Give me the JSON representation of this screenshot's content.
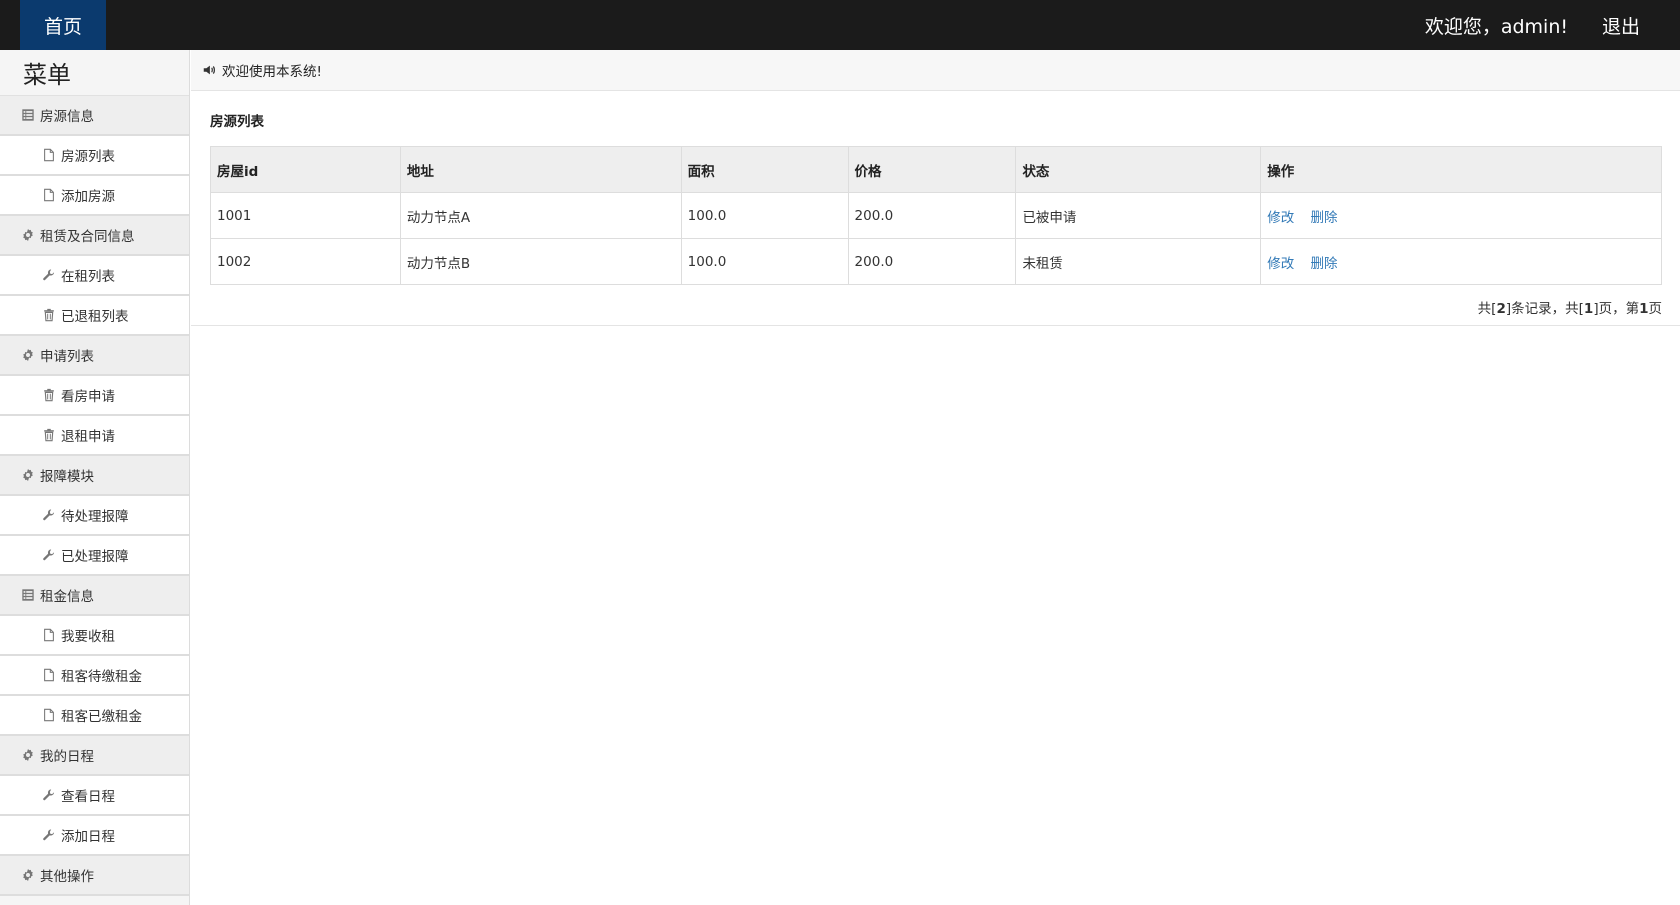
{
  "topbar": {
    "home_label": "首页",
    "welcome_text": "欢迎您，admin!",
    "logout_label": "退出"
  },
  "sidebar": {
    "title": "菜单",
    "groups": [
      {
        "label": "房源信息",
        "icon": "list-alt-icon",
        "items": [
          {
            "label": "房源列表",
            "icon": "file-icon"
          },
          {
            "label": "添加房源",
            "icon": "file-icon"
          }
        ]
      },
      {
        "label": "租赁及合同信息",
        "icon": "gear-icon",
        "items": [
          {
            "label": "在租列表",
            "icon": "wrench-icon"
          },
          {
            "label": "已退租列表",
            "icon": "trash-icon"
          }
        ]
      },
      {
        "label": "申请列表",
        "icon": "gear-icon",
        "items": [
          {
            "label": "看房申请",
            "icon": "trash-icon"
          },
          {
            "label": "退租申请",
            "icon": "trash-icon"
          }
        ]
      },
      {
        "label": "报障模块",
        "icon": "gear-icon",
        "items": [
          {
            "label": "待处理报障",
            "icon": "wrench-icon"
          },
          {
            "label": "已处理报障",
            "icon": "wrench-icon"
          }
        ]
      },
      {
        "label": "租金信息",
        "icon": "list-alt-icon",
        "items": [
          {
            "label": "我要收租",
            "icon": "file-icon"
          },
          {
            "label": "租客待缴租金",
            "icon": "file-icon"
          },
          {
            "label": "租客已缴租金",
            "icon": "file-icon"
          }
        ]
      },
      {
        "label": "我的日程",
        "icon": "gear-icon",
        "items": [
          {
            "label": "查看日程",
            "icon": "wrench-icon"
          },
          {
            "label": "添加日程",
            "icon": "wrench-icon"
          }
        ]
      },
      {
        "label": "其他操作",
        "icon": "gear-icon",
        "items": []
      }
    ]
  },
  "notice": {
    "text": "欢迎使用本系统!",
    "icon": "volume-up-icon"
  },
  "main": {
    "section_title": "房源列表",
    "table": {
      "headers": [
        "房屋id",
        "地址",
        "面积",
        "价格",
        "状态",
        "操作"
      ],
      "rows": [
        {
          "id": "1001",
          "address": "动力节点A",
          "area": "100.0",
          "price": "200.0",
          "status": "已被申请",
          "edit": "修改",
          "delete": "删除"
        },
        {
          "id": "1002",
          "address": "动力节点B",
          "area": "100.0",
          "price": "200.0",
          "status": "未租赁",
          "edit": "修改",
          "delete": "删除"
        }
      ]
    },
    "pager": {
      "prefix": "共[",
      "total_records": "2",
      "mid1": "]条记录，共[",
      "total_pages": "1",
      "mid2": "]页，第",
      "current_page": "1",
      "suffix": "页"
    }
  },
  "colors": {
    "topbar": "#1b1b1b",
    "home_tab": "#0b3a6e",
    "link": "#337ab7"
  }
}
